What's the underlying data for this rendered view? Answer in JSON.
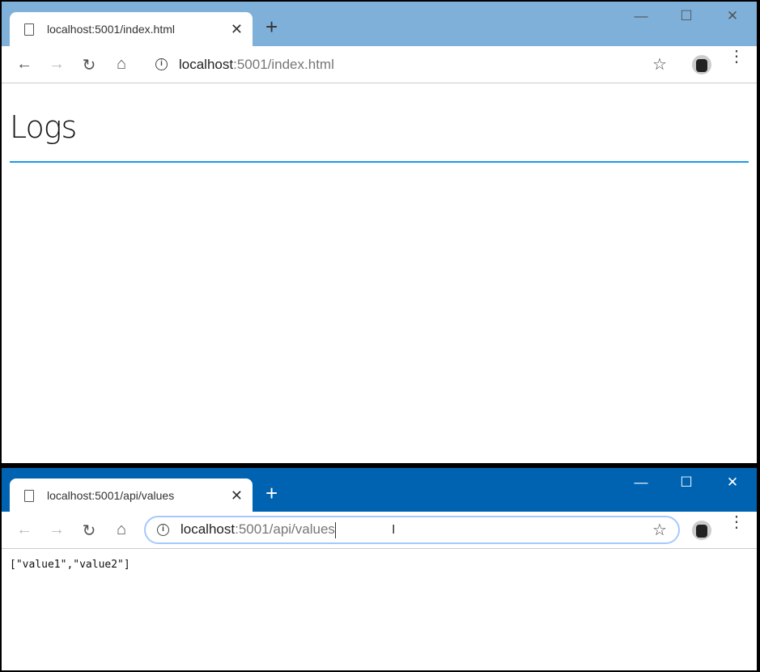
{
  "windows": [
    {
      "tab_title": "localhost:5001/index.html",
      "url_host": "localhost",
      "url_rest": ":5001/index.html",
      "page_heading": "Logs"
    },
    {
      "tab_title": "localhost:5001/api/values",
      "url_host": "localhost",
      "url_rest": ":5001/api/values",
      "page_body": "[\"value1\",\"value2\"]"
    }
  ],
  "icons": {
    "new_tab": "+",
    "close": "✕",
    "minimize": "—",
    "maximize": "☐",
    "window_close": "✕",
    "back": "←",
    "forward": "→",
    "reload": "↻",
    "home": "⌂",
    "star": "☆",
    "menu": "⋮",
    "info": "i"
  }
}
